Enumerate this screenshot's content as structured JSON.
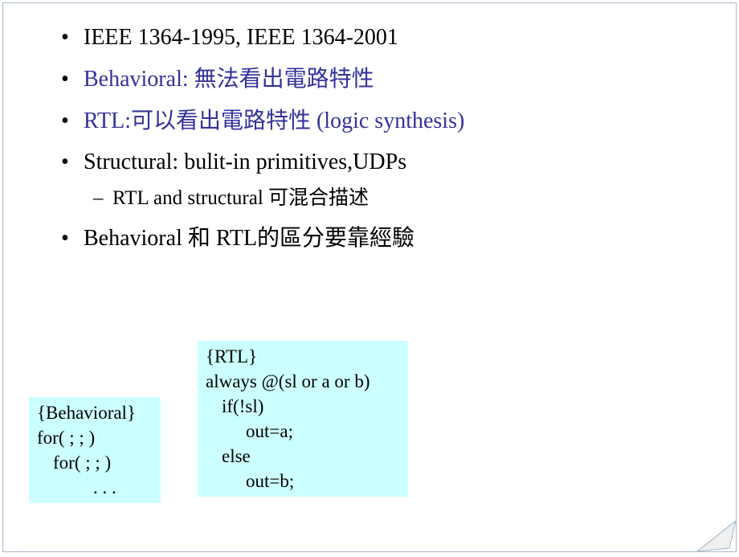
{
  "bullets": {
    "b1": "IEEE 1364-1995, IEEE 1364-2001",
    "b2": "Behavioral: 無法看出電路特性",
    "b3": "RTL:可以看出電路特性 (logic synthesis)",
    "b4": "Structural: bulit-in primitives,UDPs",
    "b4_sub": "RTL and structural 可混合描述",
    "b5": "Behavioral 和 RTL的區分要靠經驗"
  },
  "code_behavioral": {
    "l1": "{Behavioral}",
    "l2": "for(   ;  ;   )",
    "l3": "for(   ;  ;   )",
    "l4": ". . ."
  },
  "code_rtl": {
    "l1": "{RTL}",
    "l2": "always @(sl or a or b)",
    "l3": "if(!sl)",
    "l4": "out=a;",
    "l5": "else",
    "l6": "out=b;"
  }
}
